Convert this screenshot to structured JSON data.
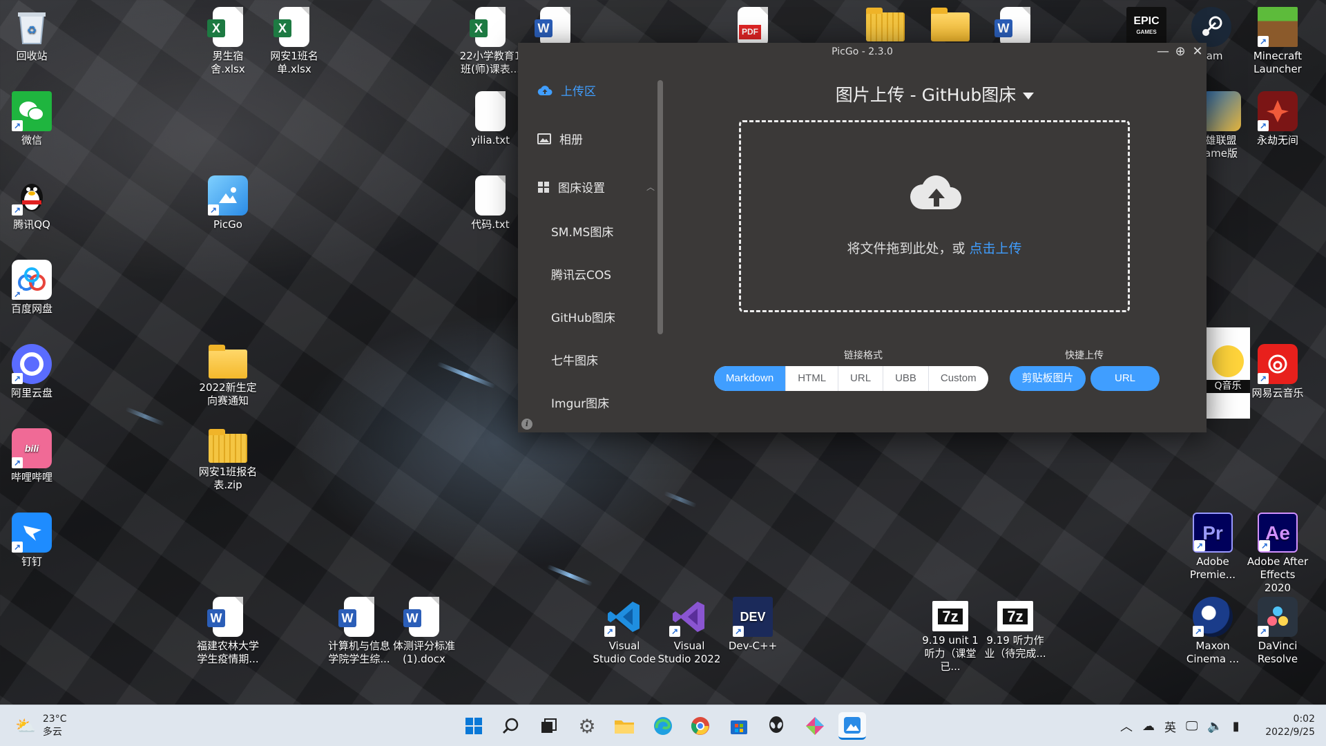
{
  "desktop": {
    "icons": [
      {
        "label": "回收站"
      },
      {
        "label": "微信"
      },
      {
        "label": "腾讯QQ"
      },
      {
        "label": "百度网盘"
      },
      {
        "label": "阿里云盘"
      },
      {
        "label": "哔哩哔哩"
      },
      {
        "label": "钉钉"
      },
      {
        "label": "男生宿舍.xlsx"
      },
      {
        "label": "网安1班名单.xlsx"
      },
      {
        "label": "PicGo"
      },
      {
        "label": "2022新生定向赛通知"
      },
      {
        "label": "网安1班报名表.zip"
      },
      {
        "label": "福建农林大学学生疫情期..."
      },
      {
        "label": "计算机与信息学院学生综..."
      },
      {
        "label": "体测评分标准(1).docx"
      },
      {
        "label": "22小学教育1班(师)课表..."
      },
      {
        "label": "yilia.txt"
      },
      {
        "label": "代码.txt"
      },
      {
        "label": "Visual Studio Code"
      },
      {
        "label": "Visual Studio 2022"
      },
      {
        "label": "Dev-C++"
      },
      {
        "label": "9.19 unit 1听力（课堂已..."
      },
      {
        "label": "9.19 听力作业（待完成..."
      },
      {
        "label": "eam"
      },
      {
        "label": "Minecraft Launcher"
      },
      {
        "label": "雄联盟 ame版"
      },
      {
        "label": "永劫无间"
      },
      {
        "label": "Q音乐"
      },
      {
        "label": "网易云音乐"
      },
      {
        "label": "Adobe Premie..."
      },
      {
        "label": "Adobe After Effects 2020"
      },
      {
        "label": "Maxon Cinema ..."
      },
      {
        "label": "DaVinci Resolve"
      }
    ],
    "badges": {
      "epic": "EPIC",
      "epic_sub": "GAMES",
      "pdf": "PDF",
      "pr": "Pr",
      "ae": "Ae",
      "dev": "DEV",
      "sevenzip": "7z"
    }
  },
  "picgo": {
    "title": "PicGo - 2.3.0",
    "controls": {
      "minimize": "—",
      "pin": "⊕",
      "close": "✕"
    },
    "sidebar": {
      "upload": "上传区",
      "album": "相册",
      "settings": "图床设置",
      "subs": [
        "SM.MS图床",
        "腾讯云COS",
        "GitHub图床",
        "七牛图床",
        "Imgur图床"
      ]
    },
    "main_title": "图片上传 - GitHub图床",
    "drop_text": "将文件拖到此处，或 ",
    "drop_link": "点击上传",
    "link_format_label": "链接格式",
    "link_formats": [
      "Markdown",
      "HTML",
      "URL",
      "UBB",
      "Custom"
    ],
    "active_format": "Markdown",
    "quick_upload_label": "快捷上传",
    "quick_buttons": [
      "剪贴板图片",
      "URL"
    ]
  },
  "taskbar": {
    "weather_temp": "23°C",
    "weather_desc": "多云",
    "ime": "英",
    "time": "0:02",
    "date": "2022/9/25"
  },
  "colors": {
    "accent": "#409eff",
    "window_bg": "#3b3938",
    "taskbar_bg": "#dfe6ee"
  }
}
